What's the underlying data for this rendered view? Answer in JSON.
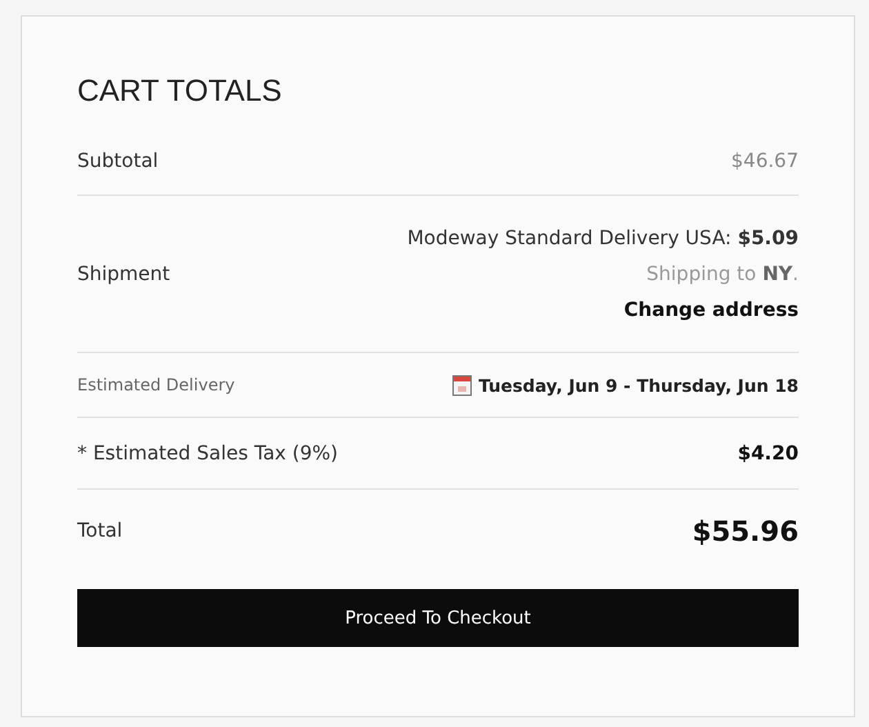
{
  "title": "CART TOTALS",
  "rows": [
    {
      "kind": "plain",
      "label": "Subtotal",
      "value": "$46.67"
    },
    {
      "kind": "shipment",
      "label": "Shipment",
      "method": "Modeway Standard Delivery USA: **$5.09**",
      "destination": "Shipping to **NY**.",
      "link": "Change address"
    },
    {
      "kind": "delivery",
      "label": "Estimated Delivery",
      "value": "Tuesday, Jun 9 - Thursday, Jun 18"
    },
    {
      "kind": "tax",
      "label": "* Estimated Sales Tax (9%)",
      "value": "$4.20"
    },
    {
      "kind": "total",
      "label": "Total",
      "value": "$55.96"
    }
  ],
  "button": "Proceed To Checkout"
}
